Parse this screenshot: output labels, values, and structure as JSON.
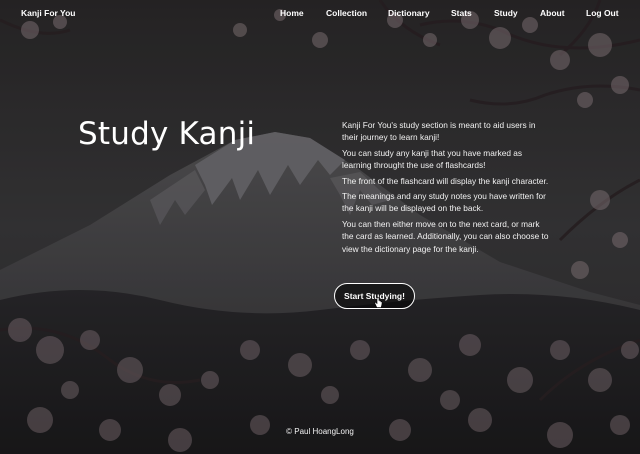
{
  "navbar": {
    "brand": "Kanji For You",
    "links": [
      "Home",
      "Collection",
      "Dictionary",
      "Stats",
      "Study",
      "About",
      "Log Out"
    ]
  },
  "hero": {
    "title": "Study Kanji",
    "paragraphs": [
      "Kanji For You's study section is meant to aid users in their journey to learn kanji!",
      "You can study any kanji that you have marked as learning throught the use of flashcards!",
      "The front of the flashcard will display the kanji character.",
      "The meanings and any study notes you have written for the kanji will be displayed on the back.",
      "You can then either move on to the next card, or mark the card as learned. Additionally, you can also choose to view the dictionary page for the kanji."
    ],
    "button": "Start Studying!"
  },
  "footer": {
    "text": "© Paul HoangLong"
  },
  "icons": {
    "cursor": "hand-pointer-icon"
  },
  "colors": {
    "text": "#ffffff",
    "background": "#1c1b1d"
  }
}
